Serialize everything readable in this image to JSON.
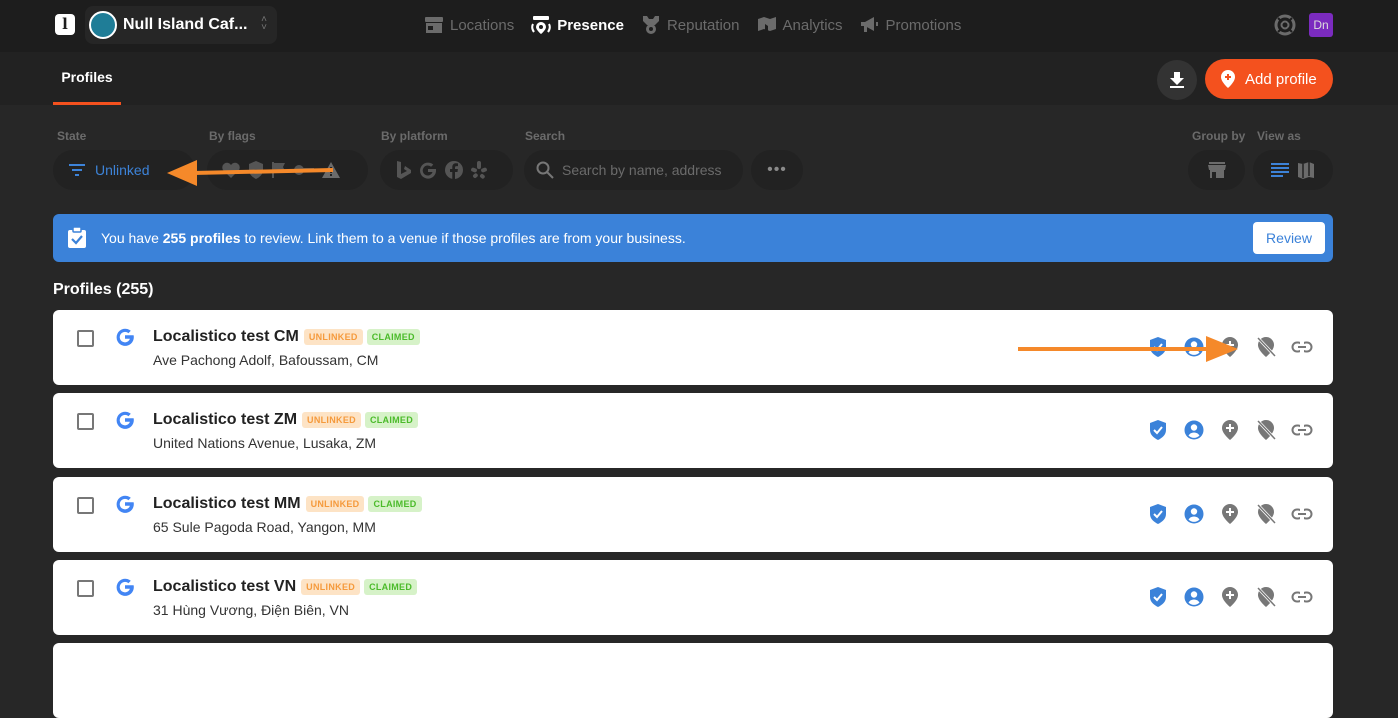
{
  "header": {
    "logo": "l",
    "venue_name": "Null Island Caf...",
    "nav": [
      {
        "label": "Locations",
        "icon": "store-icon",
        "active": false
      },
      {
        "label": "Presence",
        "icon": "presence-pin-icon",
        "active": true
      },
      {
        "label": "Reputation",
        "icon": "medal-icon",
        "active": false
      },
      {
        "label": "Analytics",
        "icon": "analytics-map-icon",
        "active": false
      },
      {
        "label": "Promotions",
        "icon": "megaphone-icon",
        "active": false
      }
    ],
    "user_initials": "Dn"
  },
  "subbar": {
    "tab_label": "Profiles",
    "add_button_label": "Add profile"
  },
  "filters": {
    "state_label": "State",
    "state_value": "Unlinked",
    "flags_label": "By flags",
    "platform_label": "By platform",
    "search_label": "Search",
    "search_placeholder": "Search by name, address",
    "group_by_label": "Group by",
    "view_as_label": "View as"
  },
  "banner": {
    "prefix": "You have ",
    "count": "255 profiles",
    "suffix": " to review. Link them to a venue if those profiles are from your business.",
    "button_label": "Review",
    "color": "#3b82d9"
  },
  "list": {
    "title": "Profiles (255)",
    "profiles": [
      {
        "name": "Localistico test CM",
        "address": "Ave Pachong Adolf, Bafoussam, CM",
        "platform": "google",
        "badges": [
          "UNLINKED",
          "CLAIMED"
        ]
      },
      {
        "name": "Localistico test ZM",
        "address": "United Nations Avenue, Lusaka, ZM",
        "platform": "google",
        "badges": [
          "UNLINKED",
          "CLAIMED"
        ]
      },
      {
        "name": "Localistico test MM",
        "address": "65 Sule Pagoda Road, Yangon, MM",
        "platform": "google",
        "badges": [
          "UNLINKED",
          "CLAIMED"
        ]
      },
      {
        "name": "Localistico test VN",
        "address": "31 Hùng Vương, Điện Biên, VN",
        "platform": "google",
        "badges": [
          "UNLINKED",
          "CLAIMED"
        ]
      }
    ]
  },
  "colors": {
    "accent": "#f4511e",
    "link_blue": "#3d83d8",
    "unlinked_badge": "#fde3c5",
    "claimed_badge": "#d6f2c8",
    "annotation_arrow": "#f5892a"
  }
}
